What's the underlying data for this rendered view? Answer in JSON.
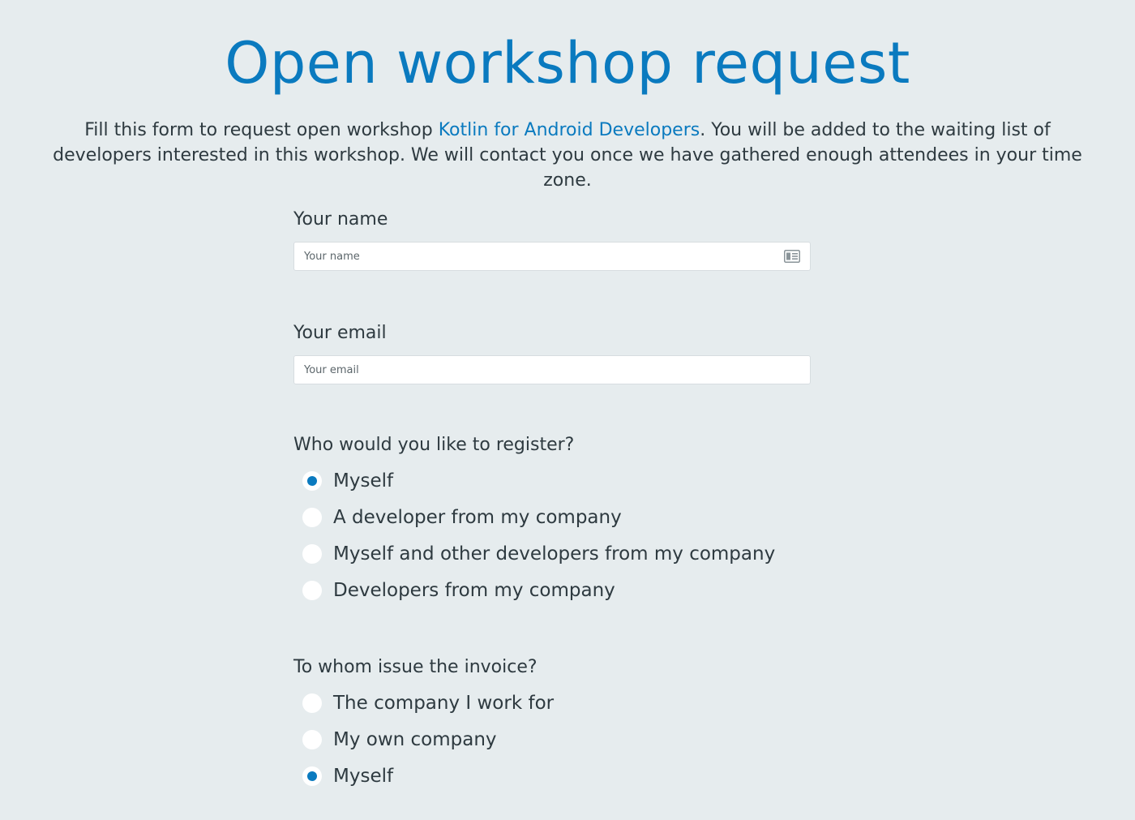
{
  "header": {
    "title": "Open workshop request"
  },
  "intro": {
    "text_before": "Fill this form to request open workshop ",
    "link_text": "Kotlin for Android Developers",
    "text_after": ". You will be added to the waiting list of developers interested in this workshop. We will contact you once we have gathered enough attendees in your time zone."
  },
  "form": {
    "name": {
      "label": "Your name",
      "placeholder": "Your name",
      "value": "",
      "icon": "contact-card-icon"
    },
    "email": {
      "label": "Your email",
      "placeholder": "Your email",
      "value": ""
    },
    "register": {
      "question": "Who would you like to register?",
      "options": [
        {
          "label": "Myself",
          "checked": true
        },
        {
          "label": "A developer from my company",
          "checked": false
        },
        {
          "label": "Myself and other developers from my company",
          "checked": false
        },
        {
          "label": "Developers from my company",
          "checked": false
        }
      ]
    },
    "invoice": {
      "question": "To whom issue the invoice?",
      "options": [
        {
          "label": "The company I work for",
          "checked": false
        },
        {
          "label": "My own company",
          "checked": false
        },
        {
          "label": "Myself",
          "checked": true
        }
      ]
    }
  },
  "colors": {
    "accent": "#0a7abf",
    "background": "#e6ecee",
    "text": "#2e3a40"
  }
}
